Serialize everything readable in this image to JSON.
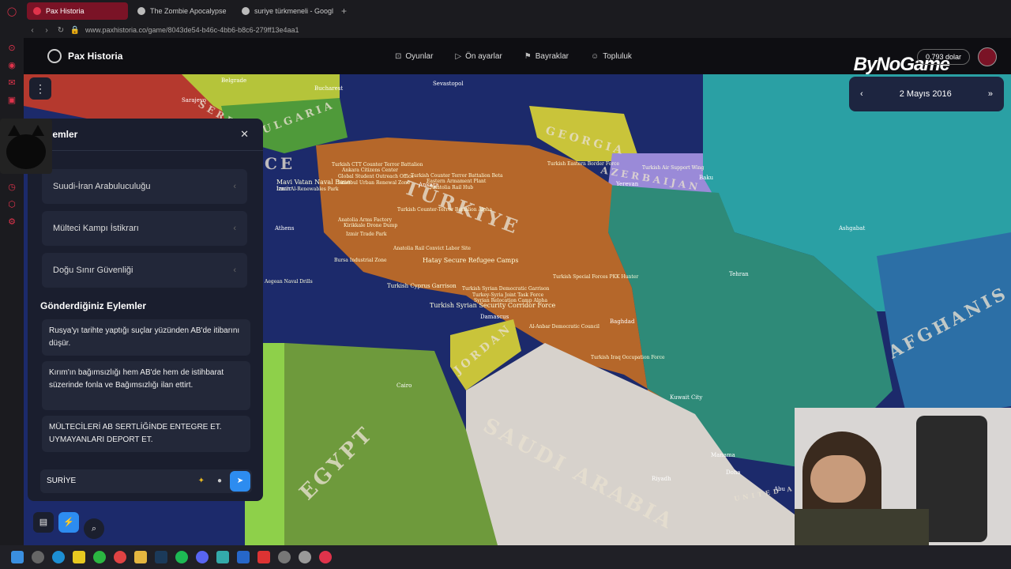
{
  "browser": {
    "tabs": [
      {
        "title": "Pax Historia",
        "active": true
      },
      {
        "title": "The Zombie Apocalypse",
        "active": false
      },
      {
        "title": "suriye türkmeneli - Googl",
        "active": false
      }
    ],
    "url": "www.paxhistoria.co/game/8043de54-b46c-4bb6-b8c6-279ff13e4aa1"
  },
  "header": {
    "app_name": "Pax Historia",
    "nav": [
      {
        "label": "Oyunlar",
        "icon": "gamepad-icon"
      },
      {
        "label": "Ön ayarlar",
        "icon": "play-icon"
      },
      {
        "label": "Bayraklar",
        "icon": "flag-icon"
      },
      {
        "label": "Topluluk",
        "icon": "users-icon"
      }
    ],
    "balance": "0,793 dolar",
    "overlay_brand": "ByNoGame"
  },
  "date_widget": {
    "date": "2 Mayıs 2016"
  },
  "panel": {
    "title": "lemler",
    "actions": [
      "Suudi-İran Arabuluculuğu",
      "Mülteci Kampı İstikrarı",
      "Doğu Sınır Güvenliği"
    ],
    "sent_title": "Gönderdiğiniz Eylemler",
    "sent": [
      "Rusya'yı tarihte yaptığı suçlar yüzünden AB'de itibarını düşür.",
      "Kırım'ın bağımsızlığı hem AB'de hem de istihbarat süzerinde fonla ve Bağımsızlığı ilan ettirt.",
      "MÜLTECİLERİ AB SERTLİĞİNDE ENTEGRE ET. UYMAYANLARI DEPORT ET."
    ],
    "input_value": "SURİYE"
  },
  "map": {
    "country_labels": [
      "GEORGIA",
      "AZERBAIJAN",
      "TÜRKIYE",
      "JORDAN",
      "EGYPT",
      "SAUDI ARABIA",
      "AFGHANIS",
      "BULGARIA",
      "CE",
      "SERBIA",
      "UNITED ARAB"
    ],
    "places": [
      "Sevastopol",
      "Bucharest",
      "Belgrade",
      "Sarajevo",
      "Yerevan",
      "Baku",
      "Tehran",
      "Ashgabat",
      "Athens",
      "Cairo",
      "Damascus",
      "Baghdad",
      "Kuwait City",
      "Manama",
      "Doha",
      "Riyadh",
      "Ankara",
      "Izmir",
      "Abu"
    ],
    "annotations": [
      "Turkish Eastern Border Force",
      "Turkish Air Support Wing",
      "Turkish Counter Terror Battalion Beta",
      "Eastern Armament Plant",
      "Anatolia Rail Hub",
      "Turkish Counter-Terror Battalion Alpha",
      "Anatolia Rail Convict Labor Site",
      "Hatay Secure Refugee Camps",
      "Turkish Special Forces PKK Hunter",
      "Mavi Vatan Naval Base",
      "Izmir Al-Renewables Park",
      "Anatolia Arms Factory",
      "Kirikkale Drone Dump",
      "Izmir Trade Park",
      "Bursa Industrial Zone",
      "Aegean Naval Drills",
      "Turkish Cyprus Garrison",
      "Turkish Syrian Security Corridor Force",
      "Turkish Syrian Democratic Garrison",
      "Turkey-Syria Joint Task Force",
      "Syrian Relocation Camp Alpha",
      "Al-Anbar Democratic Council",
      "Turkish Iraq Occupation Force",
      "Global Student Outreach Office",
      "Istanbul Urban Renewal Zone",
      "Turkish CTT Counter Terror Battalion",
      "Ankara Citizens Center"
    ]
  },
  "colors": {
    "turkey": "#b5672a",
    "sea": "#1c2a6b",
    "iran": "#2e8a78",
    "saudi": "#d7d2cc",
    "egypt": "#6e9a3c",
    "jordan": "#c9c43a",
    "azerbaijan": "#9a8ad8",
    "accent": "#2d8cf0"
  }
}
